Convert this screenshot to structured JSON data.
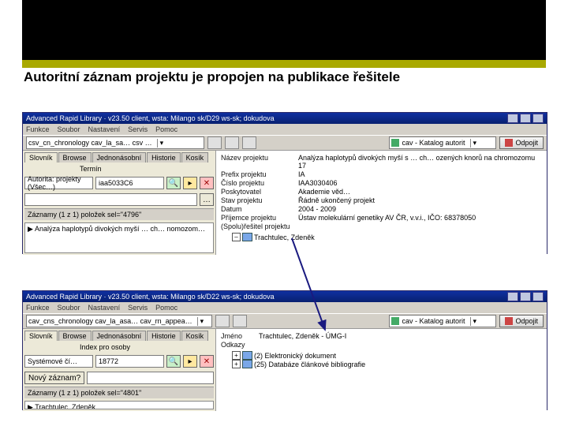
{
  "heading": "Autoritní záznam projektu je propojen na publikace řešitele",
  "win1": {
    "title": "Advanced Rapid Library · v23.50 client, wsta: Milango sk/D29 ws-sk; dokudova",
    "menu": [
      "Funkce",
      "Soubor",
      "Nastavení",
      "Servis",
      "Pomoc"
    ],
    "catcombo": "cav - Katalog autorit",
    "disconnect": "Odpojit",
    "tbcombo": "csv_cn_chronology   cav_la_sa…  csv …",
    "tabs": [
      "Slovník",
      "Browse",
      "Jednonásobní",
      "Historie",
      "Kosík"
    ],
    "leftlabel": "Termín",
    "combo2": "Autorita: projekty (Všec…)",
    "input": "iaa5033C6",
    "status": "Záznamy (1 z 1) položek           sel=\"4796\"",
    "result": "Analýza haplotypů divokých myší … ch… nomozom…",
    "fields": [
      {
        "l": "Název projektu",
        "v": "Analýza haplotypů divokých myší s … ch… ozených knorů na chromozomu 17"
      },
      {
        "l": "Prefix projektu",
        "v": "IA"
      },
      {
        "l": "Číslo projektu",
        "v": "IAA3030406"
      },
      {
        "l": "Poskytovatel",
        "v": "Akademie věd…"
      },
      {
        "l": "Stav projektu",
        "v": "Řádně ukončený projekt"
      },
      {
        "l": "Datum",
        "v": "2004 - 2009"
      },
      {
        "l": "Příjemce projektu",
        "v": "Ústav molekulární genetiky AV ČR, v.v.i., IČO: 68378050"
      },
      {
        "l": "(Spolu)řešitel projektu",
        "v": ""
      }
    ],
    "researcher": "Trachtulec, Zdeněk"
  },
  "win2": {
    "title": "Advanced Rapid Library · v23.50 client, wsta: Milango sk/D22 ws-sk; dokudova",
    "menu": [
      "Funkce",
      "Soubor",
      "Nastavení",
      "Servis",
      "Pomoc"
    ],
    "catcombo": "cav - Katalog autorit",
    "disconnect": "Odpojit",
    "tbcombo": "cav_cns_chronology   cav_la_asa…   cav_rn_appea…",
    "tabs": [
      "Slovník",
      "Browse",
      "Jednonásobní",
      "Historie",
      "Kosík"
    ],
    "leftlabel": "Index pro osoby",
    "combo2": "Systémové čí…",
    "input": "18772",
    "extra": [
      "Nový záznam?"
    ],
    "status": "Záznamy (1 z 1) položek  sel=\"4801\"",
    "result": "Trachtulec, Zdeněk",
    "fields": [
      {
        "l": "Jméno",
        "v": "Trachtulec, Zdeněk - ÚMG-I"
      },
      {
        "l": "Odkazy",
        "v": ""
      }
    ],
    "refs": [
      "(2) Elektronický dokument",
      "(25) Databáze článkové bibliografie"
    ]
  }
}
